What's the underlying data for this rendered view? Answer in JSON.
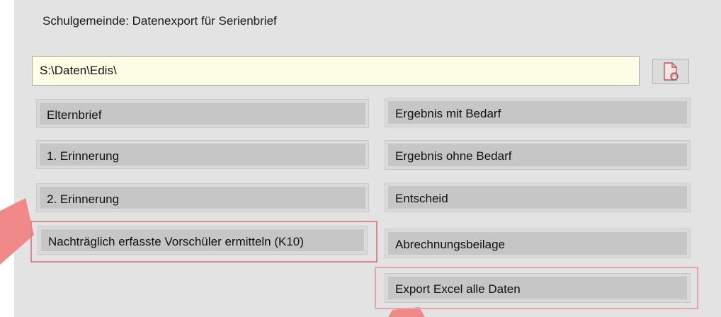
{
  "window": {
    "title": "Schulgemeinde: Datenexport für Serienbrief"
  },
  "path": {
    "value": "S:\\Daten\\Edis\\"
  },
  "icons": {
    "browse": "file-open-icon"
  },
  "buttons": {
    "left": [
      "Elternbrief",
      "1. Erinnerung",
      "2. Erinnerung",
      "Nachträglich erfasste Vorschüler ermitteln (K10)"
    ],
    "right": [
      "Ergebnis mit Bedarf",
      "Ergebnis ohne Bedarf",
      "Entscheid",
      "Abrechnungsbeilage",
      "Export Excel alle Daten"
    ]
  },
  "colors": {
    "highlight": "#d9888f",
    "arrow": "#f08a8a",
    "panel": "#e3e3e3",
    "button": "#c6c6c6"
  }
}
